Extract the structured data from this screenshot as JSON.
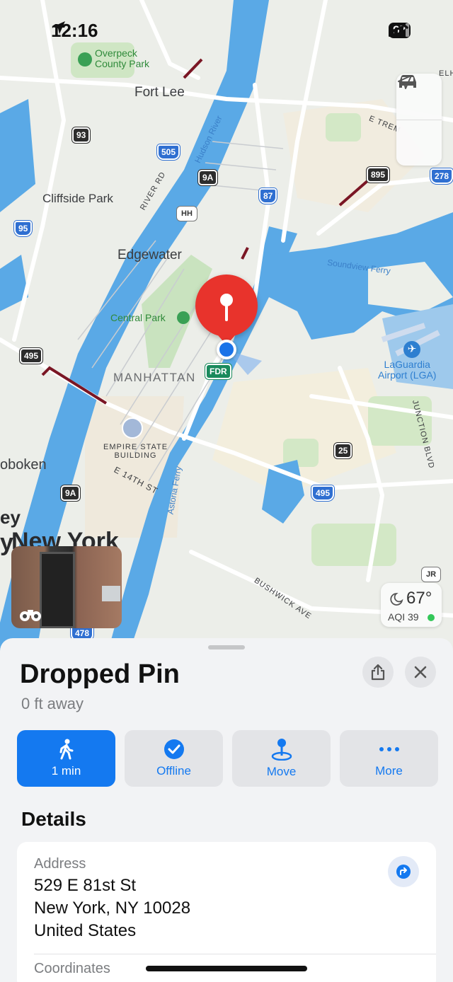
{
  "status_bar": {
    "time": "12:16",
    "battery": "97"
  },
  "map": {
    "labels": {
      "overpeck": "Overpeck\nCounty Park",
      "fort_lee": "Fort Lee",
      "cliffside_park": "Cliffside Park",
      "edgewater": "Edgewater",
      "central_park": "Central Park",
      "manhattan": "MANHATTAN",
      "empire_state": "EMPIRE STATE\nBUILDING",
      "e14th": "E 14TH ST",
      "hoboken": "oboken",
      "new_york": "New York",
      "ney": "ey",
      "y_prefix": "y",
      "hudson_river": "Hudson River",
      "river_rd": "RIVER RD",
      "soundview_ferry": "Soundview Ferry",
      "astoria_ferry": "Astoria Ferry",
      "laguardia": "LaGuardia\nAirport (LGA)",
      "junction_blvd": "JUNCTION BLVD",
      "bushwick_ave": "BUSHWICK AVE",
      "e_trem": "E TREM",
      "elh": "ELH"
    },
    "shields": {
      "r93": "93",
      "r505": "505",
      "r9a_top": "9A",
      "r87": "87",
      "r895": "895",
      "r278": "278",
      "r95": "95",
      "r495_left": "495",
      "r25": "25",
      "r495_right": "495",
      "r9a_bottom": "9A",
      "r478": "478",
      "fdr": "FDR",
      "hh": "HH",
      "jr": "JR"
    },
    "controls": {
      "drive_icon": "car-icon",
      "location_icon": "location-arrow-icon"
    },
    "weather": {
      "temperature": "67°",
      "aqi": "AQI 39",
      "aqi_color": "#34c759"
    }
  },
  "sheet": {
    "title": "Dropped Pin",
    "subtitle": "0 ft away",
    "actions": [
      {
        "label": "1 min",
        "icon": "walk-icon"
      },
      {
        "label": "Offline",
        "icon": "checkmark-circle-icon"
      },
      {
        "label": "Move",
        "icon": "move-pin-icon"
      },
      {
        "label": "More",
        "icon": "ellipsis-icon"
      }
    ],
    "details_heading": "Details",
    "address_label": "Address",
    "address_lines": [
      "529 E 81st St",
      "New York, NY  10028",
      "United States"
    ],
    "coordinates_label": "Coordinates"
  },
  "colors": {
    "accent": "#1479f0",
    "pin": "#e8332c",
    "water": "#5aa9e6"
  }
}
